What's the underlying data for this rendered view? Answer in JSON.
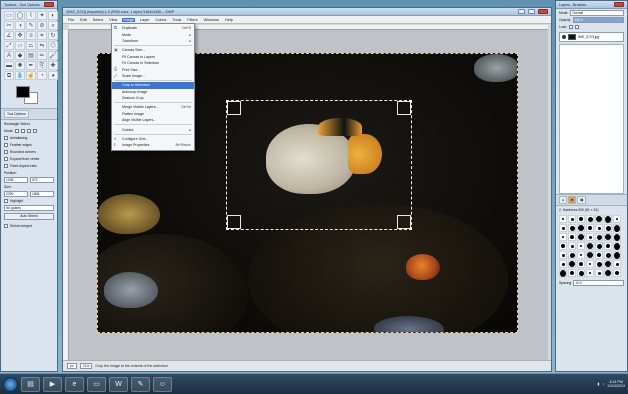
{
  "toolbox": {
    "title": "Toolbox - Tool Options",
    "tools": [
      "rect-select",
      "ellipse-select",
      "free-select",
      "fuzzy-select",
      "color-select",
      "scissors",
      "foreground-select",
      "paths",
      "color-picker",
      "zoom",
      "measure",
      "move",
      "align",
      "crop",
      "rotate",
      "scale",
      "shear",
      "perspective",
      "flip",
      "cage",
      "text",
      "bucket-fill",
      "blend",
      "pencil",
      "paintbrush",
      "eraser",
      "airbrush",
      "ink",
      "clone",
      "heal",
      "perspective-clone",
      "blur",
      "smudge",
      "dodge",
      "burn"
    ],
    "tabs": [
      "Tool Options"
    ],
    "options": {
      "section_title": "Rectangle Select",
      "mode_label": "Mode:",
      "antialiasing": "Antialiasing",
      "feather_edges": "Feather edges",
      "rounded_corners": "Rounded corners",
      "expand_from_center": "Expand from center",
      "fixed_aspect": "Fixed Aspect ratio",
      "position_label": "Position:",
      "position_x": "1008",
      "position_y": "572",
      "size_label": "Size:",
      "size_w": "2290",
      "size_h": "1808",
      "highlight": "Highlight",
      "guides": "No guides",
      "auto_shrink": "Auto Shrink",
      "shrink_merged": "Shrink merged"
    }
  },
  "gimp": {
    "title": "*[IMG_5723] (imported)-1.0 (RGB color, 1 layer) 5184x3456 – GIMP",
    "menus": [
      "File",
      "Edit",
      "Select",
      "View",
      "Image",
      "Layer",
      "Colors",
      "Tools",
      "Filters",
      "Windows",
      "Help"
    ],
    "active_menu": "Image",
    "status": {
      "unit": "px",
      "zoom": "21%",
      "message": "Crop the image to the extents of the selection"
    }
  },
  "image_menu": {
    "items": [
      {
        "icon": "duplicate-icon",
        "label": "Duplicate",
        "accel": "Ctrl+D",
        "sub": false
      },
      {
        "icon": "",
        "label": "Mode",
        "accel": "▸",
        "sub": true
      },
      {
        "icon": "",
        "label": "Transform",
        "accel": "▸",
        "sub": true
      },
      {
        "sep": true
      },
      {
        "icon": "canvas-size-icon",
        "label": "Canvas Size...",
        "accel": "",
        "sub": false
      },
      {
        "icon": "",
        "label": "Fit Canvas to Layers",
        "accel": "",
        "sub": false
      },
      {
        "icon": "",
        "label": "Fit Canvas to Selection",
        "accel": "",
        "sub": false
      },
      {
        "icon": "print-size-icon",
        "label": "Print Size...",
        "accel": "",
        "sub": false
      },
      {
        "icon": "scale-icon",
        "label": "Scale Image...",
        "accel": "",
        "sub": false
      },
      {
        "sep": true
      },
      {
        "icon": "crop-icon",
        "label": "Crop to Selection",
        "accel": "",
        "sub": false,
        "highlight": true
      },
      {
        "icon": "",
        "label": "Autocrop Image",
        "accel": "",
        "sub": false
      },
      {
        "icon": "",
        "label": "Zealous Crop",
        "accel": "",
        "sub": false
      },
      {
        "sep": true
      },
      {
        "icon": "",
        "label": "Merge Visible Layers...",
        "accel": "Ctrl+M",
        "sub": false
      },
      {
        "icon": "",
        "label": "Flatten Image",
        "accel": "",
        "sub": false
      },
      {
        "icon": "",
        "label": "Align Visible Layers...",
        "accel": "",
        "sub": false
      },
      {
        "sep": true
      },
      {
        "icon": "",
        "label": "Guides",
        "accel": "▸",
        "sub": true
      },
      {
        "sep": true
      },
      {
        "icon": "grid-icon",
        "label": "Configure Grid...",
        "accel": "",
        "sub": false
      },
      {
        "icon": "properties-icon",
        "label": "Image Properties",
        "accel": "Alt+Return",
        "sub": false
      }
    ]
  },
  "dock": {
    "title": "Layers - Brushes",
    "mode_label": "Mode:",
    "mode_value": "Normal",
    "opacity_label": "Opacity",
    "opacity_value": "100.0",
    "lock_label": "Lock:",
    "layer_name": "IMG_5723.jpg",
    "brush_name": "2. Hardness 050 (51 × 51)",
    "spacing_label": "Spacing",
    "spacing_value": "10.0"
  },
  "taskbar": {
    "time": "8:14 PM",
    "date": "11/24/2013"
  },
  "colors": {
    "accent": "#3875d7",
    "fish_body": "#cfcab8",
    "fish_fin": "#e8a13a"
  }
}
